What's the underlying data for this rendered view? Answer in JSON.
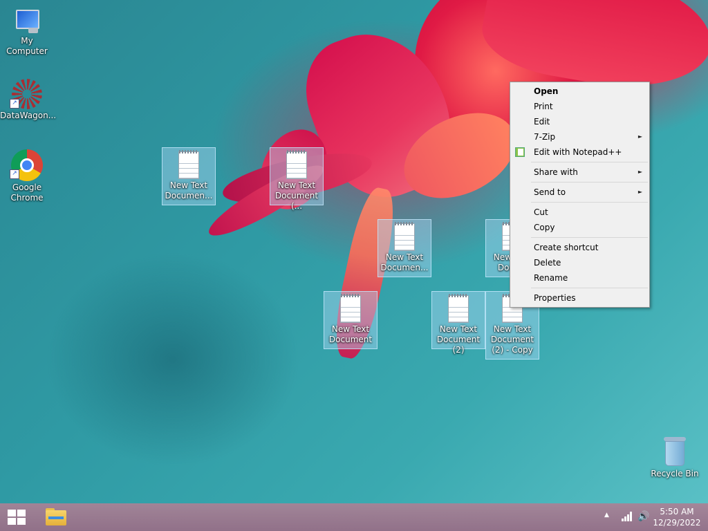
{
  "desktop": {
    "left_icons": [
      {
        "label": "My Computer"
      },
      {
        "label": "DataWagon..."
      },
      {
        "label": "Google Chrome"
      }
    ],
    "files": [
      {
        "label": "New Text Documen..."
      },
      {
        "label": "New Text Document (..."
      },
      {
        "label": "New Text Documen..."
      },
      {
        "label": "New Text Docu..."
      },
      {
        "label": "New Text Document"
      },
      {
        "label": "New Text Document (2)"
      },
      {
        "label": "New Text Document (2) - Copy"
      }
    ],
    "recycle_bin": {
      "label": "Recycle Bin"
    }
  },
  "context_menu": {
    "items": [
      {
        "label": "Open"
      },
      {
        "label": "Print"
      },
      {
        "label": "Edit"
      },
      {
        "label": "7-Zip"
      },
      {
        "label": "Edit with Notepad++"
      },
      {
        "label": "Share with"
      },
      {
        "label": "Send to"
      },
      {
        "label": "Cut"
      },
      {
        "label": "Copy"
      },
      {
        "label": "Create shortcut"
      },
      {
        "label": "Delete"
      },
      {
        "label": "Rename"
      },
      {
        "label": "Properties"
      }
    ],
    "submenu_arrow": "►"
  },
  "taskbar": {
    "tray_arrow": "▲",
    "volume_glyph": "🔊",
    "time": "5:50 AM",
    "date": "12/29/2022"
  }
}
